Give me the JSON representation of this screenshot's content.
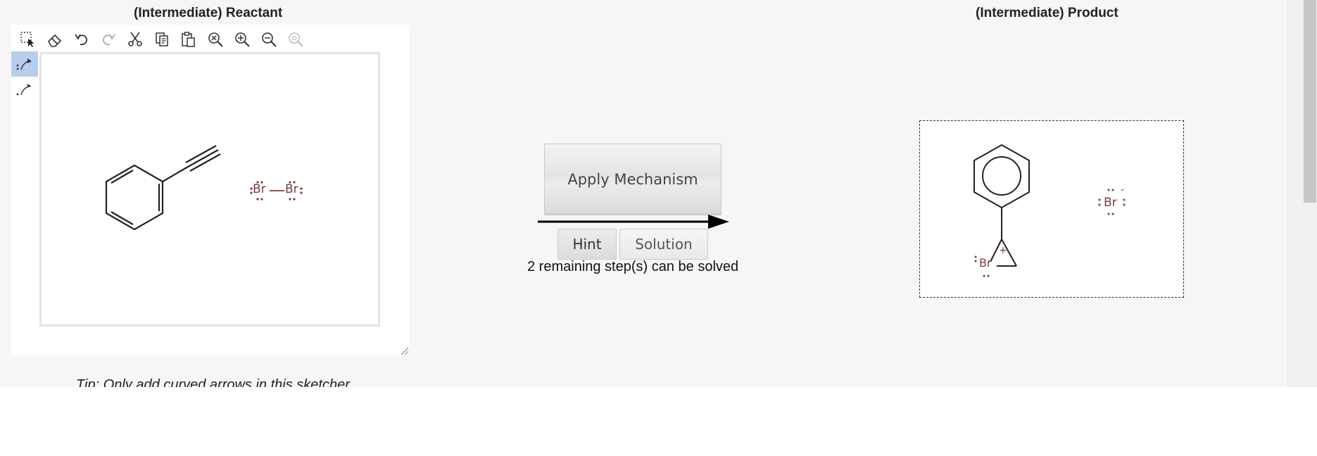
{
  "reactant": {
    "title": "(Intermediate) Reactant",
    "tip": "Tip: Only add curved arrows in this sketcher",
    "toolbar": [
      {
        "name": "select-tool",
        "icon": "marquee-select-icon"
      },
      {
        "name": "erase-tool",
        "icon": "eraser-icon"
      },
      {
        "name": "undo-tool",
        "icon": "undo-icon"
      },
      {
        "name": "redo-tool",
        "icon": "redo-icon"
      },
      {
        "name": "cut-tool",
        "icon": "scissors-icon"
      },
      {
        "name": "copy-tool",
        "icon": "copy-icon"
      },
      {
        "name": "paste-tool",
        "icon": "paste-icon"
      },
      {
        "name": "zoom-fit-tool",
        "icon": "zoom-reset-icon"
      },
      {
        "name": "zoom-in-tool",
        "icon": "zoom-in-icon"
      },
      {
        "name": "zoom-out-tool",
        "icon": "zoom-out-icon"
      },
      {
        "name": "zoom-select-tool",
        "icon": "zoom-selection-icon"
      }
    ],
    "side_tools": [
      {
        "name": "electron-pair-arrow-tool",
        "icon": "curved-arrow-pair-icon",
        "active": true
      },
      {
        "name": "single-electron-arrow-tool",
        "icon": "curved-arrow-single-icon",
        "active": false
      }
    ],
    "molecules": {
      "br2_left": "Br",
      "br2_right": "Br"
    }
  },
  "controls": {
    "apply_label": "Apply Mechanism",
    "hint_label": "Hint",
    "solution_label": "Solution",
    "status": "2 remaining step(s) can be solved"
  },
  "product": {
    "title": "(Intermediate) Product",
    "bromonium_label": "Br",
    "bromonium_charge": "+",
    "bromide_label": "Br",
    "bromide_charge": "-"
  },
  "colors": {
    "bromine": "#7a3b3b",
    "bond": "#222222",
    "active_tool": "#b7cdee"
  }
}
